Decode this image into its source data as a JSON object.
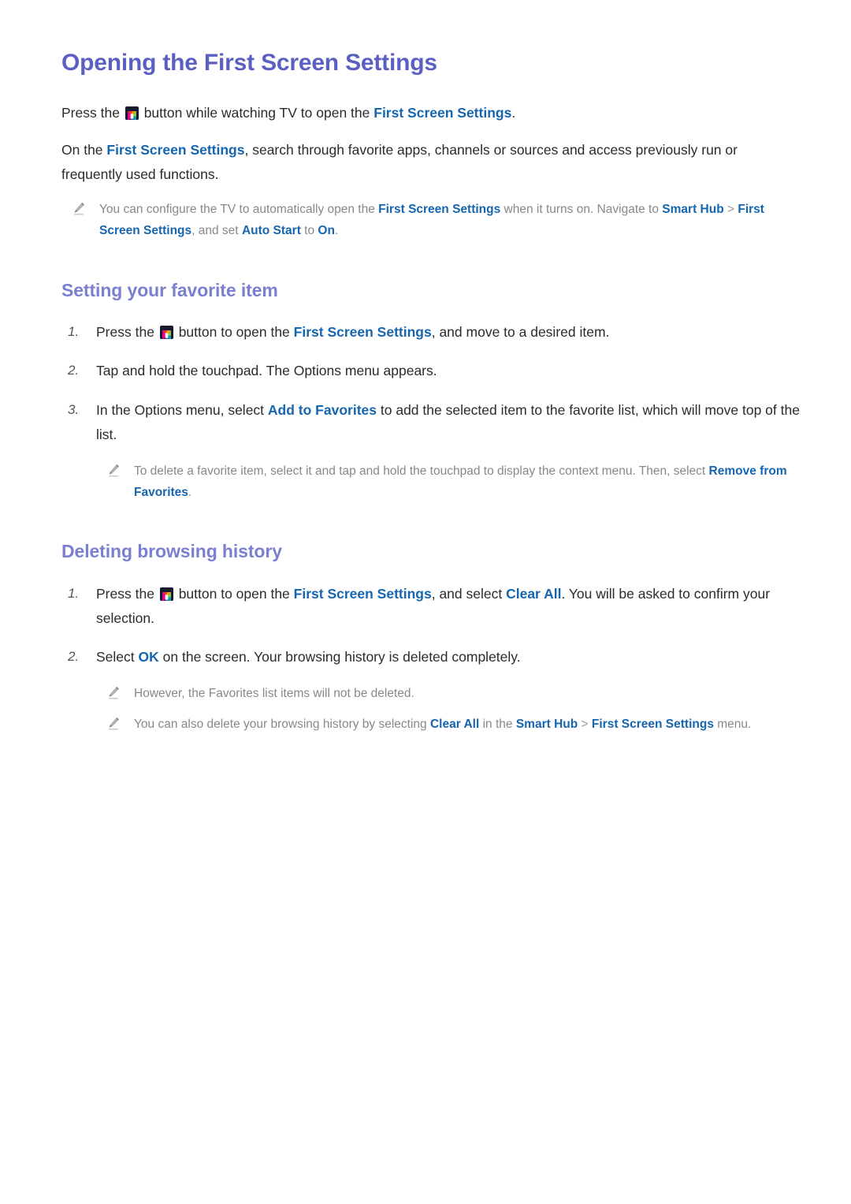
{
  "page": {
    "title": "Opening the First Screen Settings",
    "background_color": "#ffffff",
    "heading_color": "#5b5fc1",
    "subheading_color": "#7b7fd0",
    "link_color": "#1565b0",
    "body_text_color": "#2b2b2b",
    "note_text_color": "#888888"
  },
  "intro": {
    "para1": {
      "before_icon": "Press the",
      "icon": "smart-hub-button-icon",
      "after_icon": "button while watching TV to open the",
      "link": "First Screen Settings",
      "tail": "."
    },
    "para2": {
      "lead": "On the",
      "link": "First Screen Settings",
      "rest": ", search through favorite apps, channels or sources and access previously run or frequently used functions."
    },
    "note": {
      "icon": "pencil-icon",
      "part1": "You can configure the TV to automatically open the",
      "link1": "First Screen Settings",
      "part2": "when it turns on. Navigate to",
      "link2": "Smart Hub",
      "separator": ">",
      "link3": "First Screen Settings",
      "part3": ", and set",
      "link4": "Auto Start",
      "part4": "to",
      "link5": "On",
      "part5": "."
    }
  },
  "section_favorite": {
    "title": "Setting your favorite item",
    "steps": [
      {
        "number": "1.",
        "before_icon": "Press the",
        "icon": "smart-hub-button-icon",
        "after_icon": "button to open the",
        "link": "First Screen Settings",
        "tail": ", and move to a desired item."
      },
      {
        "number": "2.",
        "text": "Tap and hold the touchpad. The Options menu appears."
      },
      {
        "number": "3.",
        "before_link": "In the Options menu, select",
        "link": "Add to Favorites",
        "after_link": "to add the selected item to the favorite list, which will move top of the list."
      }
    ],
    "note": {
      "icon": "pencil-icon",
      "part1": "To delete a favorite item, select it and tap and hold the touchpad to display the context menu. Then, select",
      "link1": "Remove from Favorites",
      "part2": "."
    }
  },
  "section_history": {
    "title": "Deleting browsing history",
    "steps": [
      {
        "number": "1.",
        "before_icon": "Press the",
        "icon": "smart-hub-button-icon",
        "after_icon": "button to open the",
        "link1": "First Screen Settings",
        "middle": ", and select",
        "link2": "Clear All",
        "tail": ". You will be asked to confirm your selection."
      },
      {
        "number": "2.",
        "before_link": "Select",
        "link": "OK",
        "after_link": "on the screen. Your browsing history is deleted completely."
      }
    ],
    "notes": [
      {
        "icon": "pencil-icon",
        "text": "However, the Favorites list items will not be deleted."
      },
      {
        "icon": "pencil-icon",
        "part1": "You can also delete your browsing history by selecting",
        "link1": "Clear All",
        "part2": "in the",
        "link2": "Smart Hub",
        "separator": ">",
        "link3": "First Screen Settings",
        "part3": "menu."
      }
    ]
  }
}
